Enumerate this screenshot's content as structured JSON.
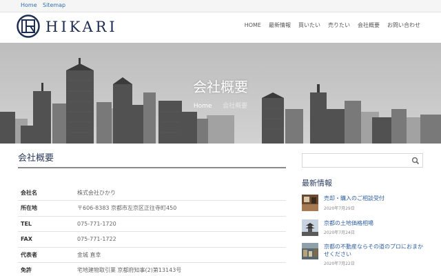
{
  "topbar": {
    "links": [
      "Home",
      "Sitemap"
    ]
  },
  "header": {
    "logo_text": "HIKARI",
    "nav": [
      "HOME",
      "最新情報",
      "買いたい",
      "売りたい",
      "会社概要",
      "お問い合わせ"
    ]
  },
  "hero": {
    "title": "会社概要",
    "breadcrumb": [
      "Home",
      "会社概要"
    ]
  },
  "main": {
    "title": "会社概要",
    "rows": [
      {
        "label": "会社名",
        "value": "株式会社ひかり"
      },
      {
        "label": "所在地",
        "value": "〒606-8383 京都市左京区正往寺町450"
      },
      {
        "label": "TEL",
        "value": "075-771-1720"
      },
      {
        "label": "FAX",
        "value": "075-771-1722"
      },
      {
        "label": "代表者",
        "value": "金城 直幸"
      },
      {
        "label": "免許",
        "value": "宅地建物取引業 京都府知事(2)第13143号"
      }
    ]
  },
  "sidebar": {
    "search_placeholder": "",
    "heading": "最新情報",
    "news": [
      {
        "title": "売却・購入のご相談受付",
        "date": "2020年7月29日",
        "thumb": "room"
      },
      {
        "title": "京都の土地価格相場",
        "date": "2020年7月24日",
        "thumb": "pagoda"
      },
      {
        "title": "京都の不動産ならその道のプロにおまかせください",
        "date": "2020年7月22日",
        "thumb": "town"
      }
    ]
  },
  "colors": {
    "brand_navy": "#1c2c52",
    "link_blue": "#2f5fa0",
    "heading": "#2b3a5c"
  }
}
